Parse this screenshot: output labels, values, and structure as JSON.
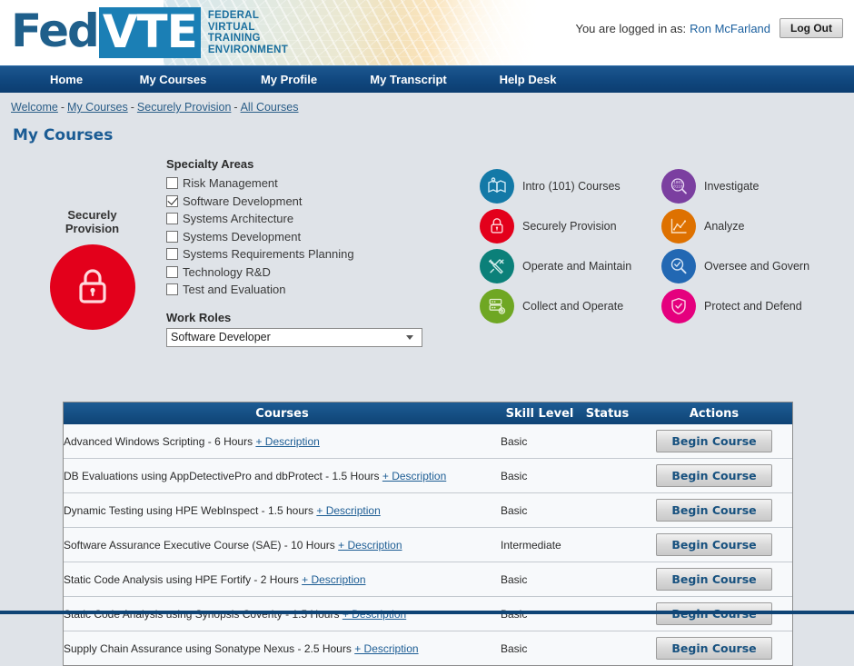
{
  "brand": {
    "logo_fed": "Fed",
    "logo_vte": "VTE",
    "logo_lines": [
      "FEDERAL",
      "VIRTUAL",
      "TRAINING",
      "ENVIRONMENT"
    ],
    "accent_blue": "#1b7fb5",
    "nav_blue": "#10477e"
  },
  "header": {
    "logged_in_prefix": "You are logged in as:",
    "user_name": "Ron McFarland",
    "logout_label": "Log Out"
  },
  "nav": {
    "items": [
      {
        "label": "Home"
      },
      {
        "label": "My Courses"
      },
      {
        "label": "My Profile"
      },
      {
        "label": "My Transcript"
      },
      {
        "label": "Help Desk"
      }
    ]
  },
  "breadcrumb": {
    "items": [
      "Welcome",
      "My Courses",
      "Securely Provision",
      "All Courses"
    ],
    "separator": "-"
  },
  "page": {
    "title": "My Courses"
  },
  "category_panel": {
    "selected_label": "Securely Provision",
    "selected_color": "#e3001b",
    "selected_icon": "lock-icon"
  },
  "specialty_areas": {
    "heading": "Specialty Areas",
    "items": [
      {
        "label": "Risk Management",
        "checked": false
      },
      {
        "label": "Software Development",
        "checked": true
      },
      {
        "label": "Systems Architecture",
        "checked": false
      },
      {
        "label": "Systems Development",
        "checked": false
      },
      {
        "label": "Systems Requirements Planning",
        "checked": false
      },
      {
        "label": "Technology R&D",
        "checked": false
      },
      {
        "label": "Test and Evaluation",
        "checked": false
      }
    ]
  },
  "work_roles": {
    "heading": "Work Roles",
    "selected": "Software Developer",
    "options": [
      "Software Developer"
    ]
  },
  "categories": [
    {
      "label": "Intro (101) Courses",
      "color": "#1379a7",
      "icon": "map-book-icon"
    },
    {
      "label": "Investigate",
      "color": "#7b3fa0",
      "icon": "binary-magnifier-icon"
    },
    {
      "label": "Securely Provision",
      "color": "#e3001b",
      "icon": "lock-icon"
    },
    {
      "label": "Analyze",
      "color": "#de7100",
      "icon": "line-chart-icon"
    },
    {
      "label": "Operate and Maintain",
      "color": "#0b8079",
      "icon": "wrench-screwdriver-icon"
    },
    {
      "label": "Oversee and Govern",
      "color": "#2268b3",
      "icon": "magnifier-check-icon"
    },
    {
      "label": "Collect and Operate",
      "color": "#6fa723",
      "icon": "server-gear-icon"
    },
    {
      "label": "Protect and Defend",
      "color": "#e5007e",
      "icon": "shield-check-icon"
    }
  ],
  "courses_table": {
    "columns": [
      "Courses",
      "Skill Level",
      "Status",
      "Actions"
    ],
    "description_link": "+ Description",
    "action_label": "Begin Course",
    "rows": [
      {
        "course": "Advanced Windows Scripting - 6 Hours",
        "skill": "Basic",
        "status": ""
      },
      {
        "course": "DB Evaluations using AppDetectivePro and dbProtect - 1.5 Hours",
        "skill": "Basic",
        "status": ""
      },
      {
        "course": "Dynamic Testing using HPE WebInspect - 1.5 hours",
        "skill": "Basic",
        "status": ""
      },
      {
        "course": "Software Assurance Executive Course (SAE) - 10 Hours",
        "skill": "Intermediate",
        "status": ""
      },
      {
        "course": "Static Code Analysis using HPE Fortify - 2 Hours",
        "skill": "Basic",
        "status": ""
      },
      {
        "course": "Static Code Analysis using Synopsis Coverity - 1.5 Hours",
        "skill": "Basic",
        "status": ""
      },
      {
        "course": "Supply Chain Assurance using Sonatype Nexus - 2.5 Hours",
        "skill": "Basic",
        "status": ""
      }
    ]
  }
}
